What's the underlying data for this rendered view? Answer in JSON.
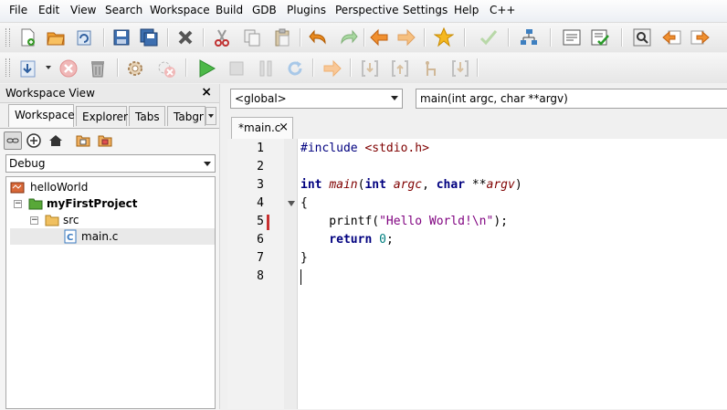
{
  "menu": [
    "File",
    "Edit",
    "View",
    "Search",
    "Workspace",
    "Build",
    "GDB",
    "Plugins",
    "Perspective",
    "Settings",
    "Help",
    "C++"
  ],
  "workspace_panel": {
    "title": "Workspace View",
    "close": "×",
    "tabs": [
      "Workspace",
      "Explorer",
      "Tabs",
      "Tabgr"
    ],
    "configuration": "Debug",
    "tree": {
      "workspace": "helloWorld",
      "project": "myFirstProject",
      "folder": "src",
      "file": "main.c"
    }
  },
  "editor": {
    "scope_combo": "<global>",
    "function_combo": "main(int argc, char **argv)",
    "tab_label": "*main.c",
    "tab_close": "×",
    "line_numbers": [
      "1",
      "2",
      "3",
      "4",
      "5",
      "6",
      "7",
      "8"
    ],
    "code": {
      "l1_pre": "#include",
      "l1_rest": " <stdio.h>",
      "l3_kw1": "int",
      "l3_fn": "main",
      "l3_p1": "(",
      "l3_kw2": "int",
      "l3_a1": "argc",
      "l3_comma": ", ",
      "l3_kw3": "char",
      "l3_stars": " **",
      "l3_a2": "argv",
      "l3_close": ")",
      "l4": "{",
      "l5_call": "    printf(",
      "l5_str": "\"Hello World!\\n\"",
      "l5_end": ");",
      "l6_kw": "    return",
      "l6_num": " 0",
      "l6_end": ";",
      "l7": "}"
    }
  }
}
